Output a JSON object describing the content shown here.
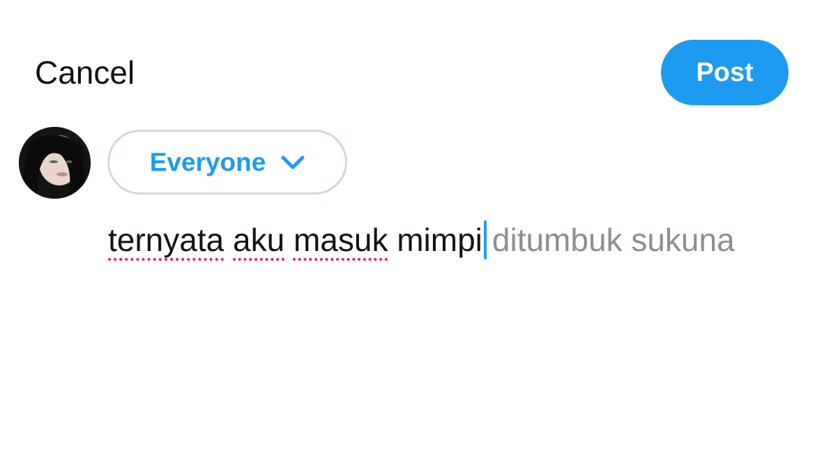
{
  "header": {
    "cancel_label": "Cancel",
    "post_label": "Post"
  },
  "audience": {
    "label": "Everyone",
    "icon": "chevron-down-icon"
  },
  "composer": {
    "typed_words": [
      "ternyata",
      "aku",
      "masuk",
      "mimpi"
    ],
    "suggestion": "ditumbuk sukuna"
  },
  "colors": {
    "accent": "#1d9bf0",
    "text": "#0f1419",
    "suggestion": "#8b8f94",
    "spellcheck": "#e0245e",
    "pill_border": "#cfd9de"
  }
}
